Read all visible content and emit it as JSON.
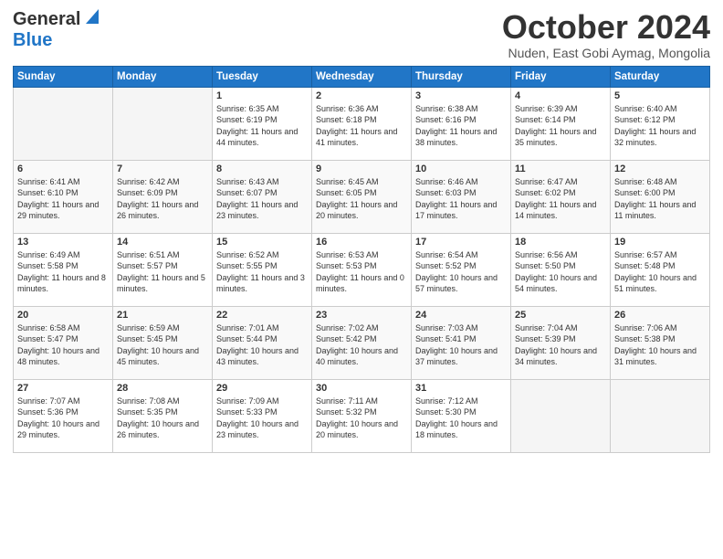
{
  "header": {
    "logo_line1": "General",
    "logo_line2": "Blue",
    "month": "October 2024",
    "location": "Nuden, East Gobi Aymag, Mongolia"
  },
  "weekdays": [
    "Sunday",
    "Monday",
    "Tuesday",
    "Wednesday",
    "Thursday",
    "Friday",
    "Saturday"
  ],
  "weeks": [
    [
      {
        "day": "",
        "info": ""
      },
      {
        "day": "",
        "info": ""
      },
      {
        "day": "1",
        "info": "Sunrise: 6:35 AM\nSunset: 6:19 PM\nDaylight: 11 hours and 44 minutes."
      },
      {
        "day": "2",
        "info": "Sunrise: 6:36 AM\nSunset: 6:18 PM\nDaylight: 11 hours and 41 minutes."
      },
      {
        "day": "3",
        "info": "Sunrise: 6:38 AM\nSunset: 6:16 PM\nDaylight: 11 hours and 38 minutes."
      },
      {
        "day": "4",
        "info": "Sunrise: 6:39 AM\nSunset: 6:14 PM\nDaylight: 11 hours and 35 minutes."
      },
      {
        "day": "5",
        "info": "Sunrise: 6:40 AM\nSunset: 6:12 PM\nDaylight: 11 hours and 32 minutes."
      }
    ],
    [
      {
        "day": "6",
        "info": "Sunrise: 6:41 AM\nSunset: 6:10 PM\nDaylight: 11 hours and 29 minutes."
      },
      {
        "day": "7",
        "info": "Sunrise: 6:42 AM\nSunset: 6:09 PM\nDaylight: 11 hours and 26 minutes."
      },
      {
        "day": "8",
        "info": "Sunrise: 6:43 AM\nSunset: 6:07 PM\nDaylight: 11 hours and 23 minutes."
      },
      {
        "day": "9",
        "info": "Sunrise: 6:45 AM\nSunset: 6:05 PM\nDaylight: 11 hours and 20 minutes."
      },
      {
        "day": "10",
        "info": "Sunrise: 6:46 AM\nSunset: 6:03 PM\nDaylight: 11 hours and 17 minutes."
      },
      {
        "day": "11",
        "info": "Sunrise: 6:47 AM\nSunset: 6:02 PM\nDaylight: 11 hours and 14 minutes."
      },
      {
        "day": "12",
        "info": "Sunrise: 6:48 AM\nSunset: 6:00 PM\nDaylight: 11 hours and 11 minutes."
      }
    ],
    [
      {
        "day": "13",
        "info": "Sunrise: 6:49 AM\nSunset: 5:58 PM\nDaylight: 11 hours and 8 minutes."
      },
      {
        "day": "14",
        "info": "Sunrise: 6:51 AM\nSunset: 5:57 PM\nDaylight: 11 hours and 5 minutes."
      },
      {
        "day": "15",
        "info": "Sunrise: 6:52 AM\nSunset: 5:55 PM\nDaylight: 11 hours and 3 minutes."
      },
      {
        "day": "16",
        "info": "Sunrise: 6:53 AM\nSunset: 5:53 PM\nDaylight: 11 hours and 0 minutes."
      },
      {
        "day": "17",
        "info": "Sunrise: 6:54 AM\nSunset: 5:52 PM\nDaylight: 10 hours and 57 minutes."
      },
      {
        "day": "18",
        "info": "Sunrise: 6:56 AM\nSunset: 5:50 PM\nDaylight: 10 hours and 54 minutes."
      },
      {
        "day": "19",
        "info": "Sunrise: 6:57 AM\nSunset: 5:48 PM\nDaylight: 10 hours and 51 minutes."
      }
    ],
    [
      {
        "day": "20",
        "info": "Sunrise: 6:58 AM\nSunset: 5:47 PM\nDaylight: 10 hours and 48 minutes."
      },
      {
        "day": "21",
        "info": "Sunrise: 6:59 AM\nSunset: 5:45 PM\nDaylight: 10 hours and 45 minutes."
      },
      {
        "day": "22",
        "info": "Sunrise: 7:01 AM\nSunset: 5:44 PM\nDaylight: 10 hours and 43 minutes."
      },
      {
        "day": "23",
        "info": "Sunrise: 7:02 AM\nSunset: 5:42 PM\nDaylight: 10 hours and 40 minutes."
      },
      {
        "day": "24",
        "info": "Sunrise: 7:03 AM\nSunset: 5:41 PM\nDaylight: 10 hours and 37 minutes."
      },
      {
        "day": "25",
        "info": "Sunrise: 7:04 AM\nSunset: 5:39 PM\nDaylight: 10 hours and 34 minutes."
      },
      {
        "day": "26",
        "info": "Sunrise: 7:06 AM\nSunset: 5:38 PM\nDaylight: 10 hours and 31 minutes."
      }
    ],
    [
      {
        "day": "27",
        "info": "Sunrise: 7:07 AM\nSunset: 5:36 PM\nDaylight: 10 hours and 29 minutes."
      },
      {
        "day": "28",
        "info": "Sunrise: 7:08 AM\nSunset: 5:35 PM\nDaylight: 10 hours and 26 minutes."
      },
      {
        "day": "29",
        "info": "Sunrise: 7:09 AM\nSunset: 5:33 PM\nDaylight: 10 hours and 23 minutes."
      },
      {
        "day": "30",
        "info": "Sunrise: 7:11 AM\nSunset: 5:32 PM\nDaylight: 10 hours and 20 minutes."
      },
      {
        "day": "31",
        "info": "Sunrise: 7:12 AM\nSunset: 5:30 PM\nDaylight: 10 hours and 18 minutes."
      },
      {
        "day": "",
        "info": ""
      },
      {
        "day": "",
        "info": ""
      }
    ]
  ]
}
